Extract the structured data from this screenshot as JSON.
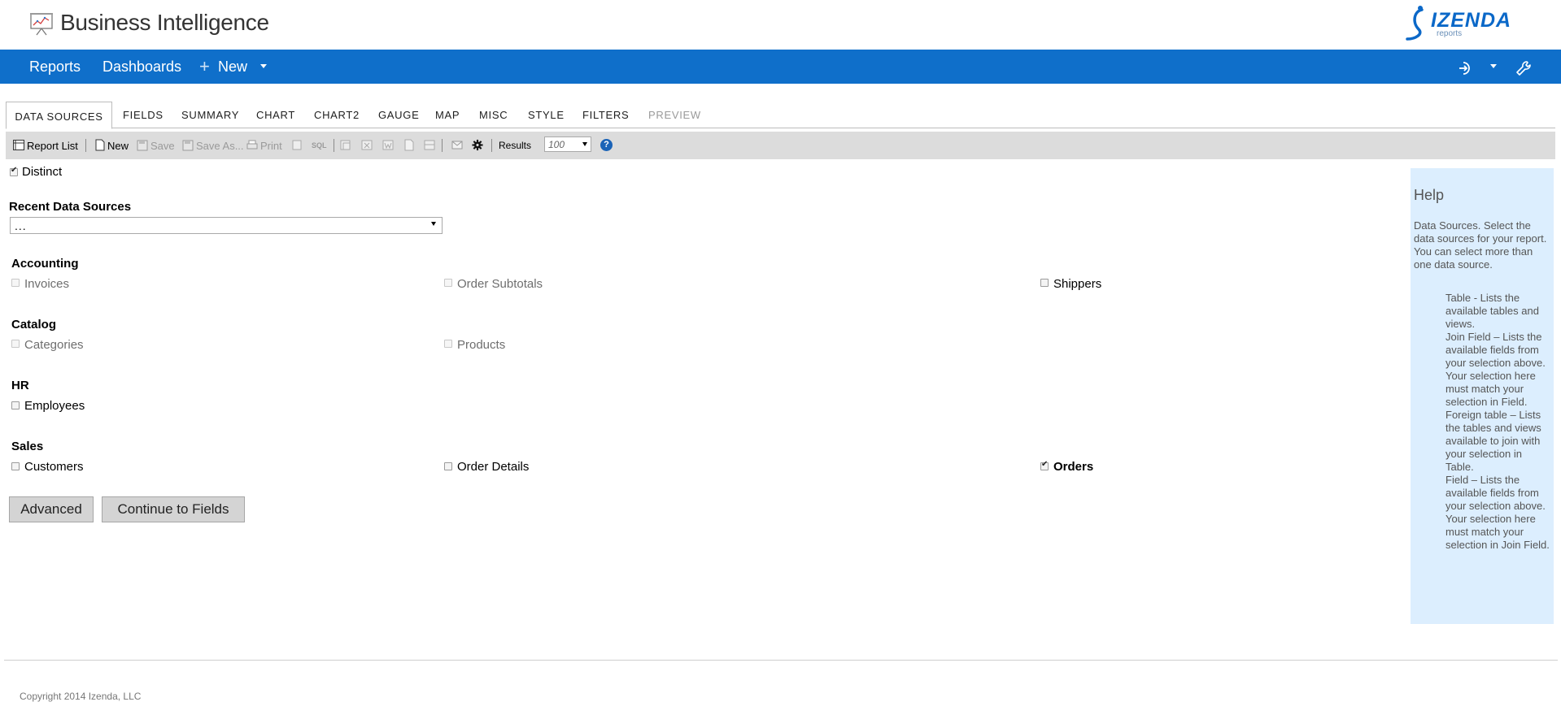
{
  "header": {
    "title": "Business Intelligence",
    "brand": "IZENDA",
    "brand_sub": "reports"
  },
  "nav": {
    "reports": "Reports",
    "dashboards": "Dashboards",
    "new": "New"
  },
  "tabs": [
    "DATA SOURCES",
    "FIELDS",
    "SUMMARY",
    "CHART",
    "CHART2",
    "GAUGE",
    "MAP",
    "MISC",
    "STYLE",
    "FILTERS",
    "PREVIEW"
  ],
  "toolbar": {
    "report_list": "Report List",
    "new": "New",
    "save": "Save",
    "save_as": "Save As...",
    "print": "Print",
    "sql": "SQL",
    "results_label": "Results",
    "results_value": "100"
  },
  "distinct": {
    "label": "Distinct",
    "checked": true
  },
  "recent": {
    "title": "Recent Data Sources",
    "value": "..."
  },
  "groups": {
    "accounting": {
      "title": "Accounting",
      "items": [
        "Invoices",
        "Order Subtotals",
        "Shippers"
      ]
    },
    "catalog": {
      "title": "Catalog",
      "items": [
        "Categories",
        "Products"
      ]
    },
    "hr": {
      "title": "HR",
      "items": [
        "Employees"
      ]
    },
    "sales": {
      "title": "Sales",
      "items": [
        "Customers",
        "Order Details",
        "Orders"
      ]
    }
  },
  "buttons": {
    "advanced": "Advanced",
    "continue": "Continue to Fields"
  },
  "help": {
    "title": "Help",
    "intro": "Data Sources. Select the data sources for your report. You can select more than one data source.",
    "table": "Table - Lists the available tables and views.",
    "join_field": "Join Field – Lists the available fields from your selection above. Your selection here must match your selection in Field.",
    "foreign_table": "Foreign table – Lists the tables and views available to join with your selection in Table.",
    "field": "Field – Lists the available fields from your selection above. Your selection here must match your selection in Join Field."
  },
  "footer": {
    "copyright": "Copyright 2014 Izenda, LLC"
  },
  "colors": {
    "nav": "#0f6fca",
    "brand": "#0b68c8",
    "help_bg": "#dceefe",
    "toolbar_bg": "#dcdcdc"
  }
}
